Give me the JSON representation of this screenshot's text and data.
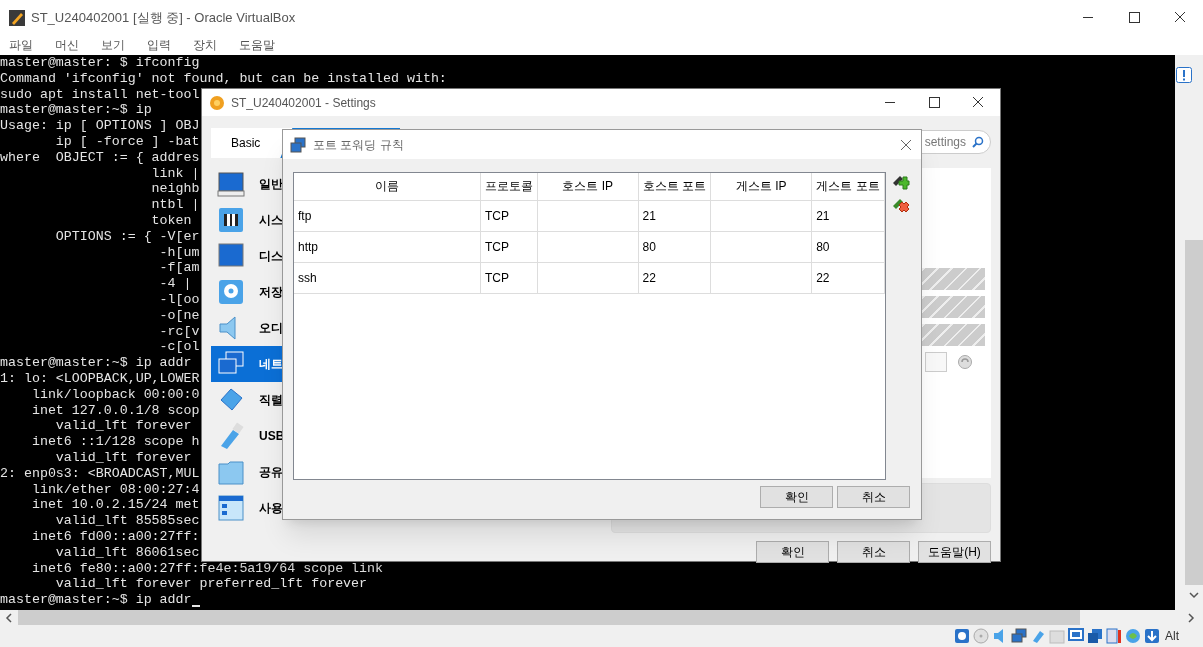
{
  "window": {
    "title": "ST_U240402001 [실행 중] - Oracle VirtualBox"
  },
  "menu": [
    "파일",
    "머신",
    "보기",
    "입력",
    "장치",
    "도움말"
  ],
  "terminal": {
    "lines": [
      "master@master: $ ifconfig",
      "Command 'ifconfig' not found, but can be installed with:",
      "sudo apt install net-tool",
      "master@master:~$ ip",
      "Usage: ip [ OPTIONS ] OBJ",
      "       ip [ -force ] -bat",
      "where  OBJECT := { addres",
      "                   link |",
      "                   neighb",
      "                   ntbl |",
      "                   token",
      "       OPTIONS := { -V[er",
      "                    -h[um",
      "                    -f[am",
      "                    -4 |",
      "                    -l[oo",
      "                    -o[ne",
      "                    -rc[v",
      "                    -c[ol",
      "master@master:~$ ip addr",
      "1: lo: <LOOPBACK,UP,LOWER",
      "    link/loopback 00:00:0",
      "    inet 127.0.0.1/8 scop",
      "       valid_lft forever",
      "    inet6 ::1/128 scope h",
      "       valid_lft forever",
      "2: enp0s3: <BROADCAST,MUL",
      "    link/ether 08:00:27:4",
      "    inet 10.0.2.15/24 met",
      "       valid_lft 85585sec",
      "    inet6 fd00::a00:27ff:",
      "       valid_lft 86061sec",
      "    inet6 fe80::a00:27ff:fe4e:5a19/64 scope link",
      "       valid_lft forever preferred_lft forever",
      "master@master:~$ ip addr"
    ]
  },
  "settings": {
    "title": "ST_U240402001 - Settings",
    "tabs": [
      {
        "label": "Basic",
        "selected": false
      },
      {
        "selected": true
      }
    ],
    "search": {
      "value": "settings"
    },
    "nav": [
      {
        "label": "일반",
        "kind": "general",
        "selected": false
      },
      {
        "label": "시스",
        "kind": "system",
        "selected": false
      },
      {
        "label": "디스",
        "kind": "display",
        "selected": false
      },
      {
        "label": "저장",
        "kind": "storage",
        "selected": false
      },
      {
        "label": "오디",
        "kind": "audio",
        "selected": false
      },
      {
        "label": "네트",
        "kind": "network",
        "selected": true
      },
      {
        "label": "직렬",
        "kind": "serial",
        "selected": false
      },
      {
        "label": "USB",
        "kind": "usb",
        "selected": false
      },
      {
        "label": "공유",
        "kind": "shared",
        "selected": false
      },
      {
        "label": "사용",
        "kind": "ui",
        "selected": false
      }
    ],
    "buttons": [
      "확인",
      "취소",
      "도움말(H)"
    ]
  },
  "port_forwarding": {
    "title": "포트 포워딩 규칙",
    "columns": [
      "이름",
      "프로토콜",
      "호스트 IP",
      "호스트 포트",
      "게스트 IP",
      "게스트 포트"
    ],
    "rows": [
      [
        "ftp",
        "TCP",
        "",
        "21",
        "",
        "21"
      ],
      [
        "http",
        "TCP",
        "",
        "80",
        "",
        "80"
      ],
      [
        "ssh",
        "TCP",
        "",
        "22",
        "",
        "22"
      ]
    ],
    "buttons": [
      "확인",
      "취소"
    ]
  },
  "status_bar": {
    "keyboard": "Alt"
  }
}
